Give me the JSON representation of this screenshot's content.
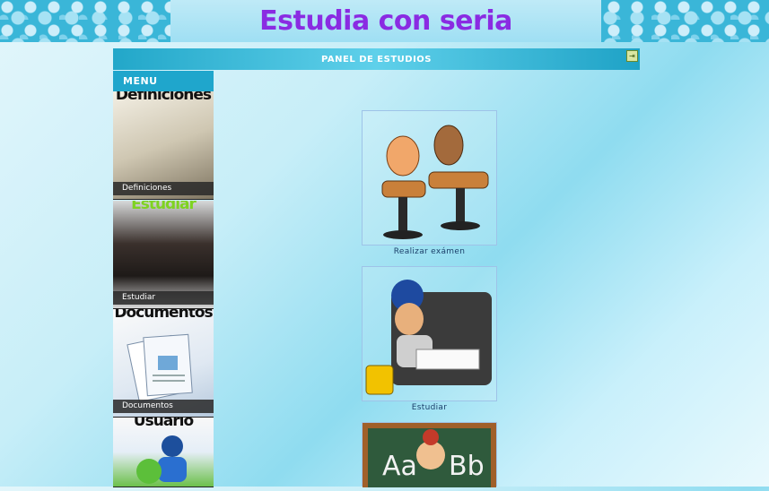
{
  "header": {
    "title": "Estudia con seria"
  },
  "panel": {
    "title": "PANEL DE ESTUDIOS",
    "exit_icon": "exit-icon"
  },
  "menu": {
    "title": "MENU",
    "items": [
      {
        "label": "Definiciones",
        "thumb_text": "Definiciones"
      },
      {
        "label": "Estudiar",
        "thumb_text": "Estudiar"
      },
      {
        "label": "Documentos",
        "thumb_text": "Documentos"
      },
      {
        "label": "",
        "thumb_text": "Usuario"
      }
    ]
  },
  "cards": [
    {
      "label": "Realizar exámen"
    },
    {
      "label": "Estudiar"
    },
    {
      "label": ""
    }
  ],
  "colors": {
    "accent": "#1fa6cc",
    "title": "#8a2be2"
  }
}
